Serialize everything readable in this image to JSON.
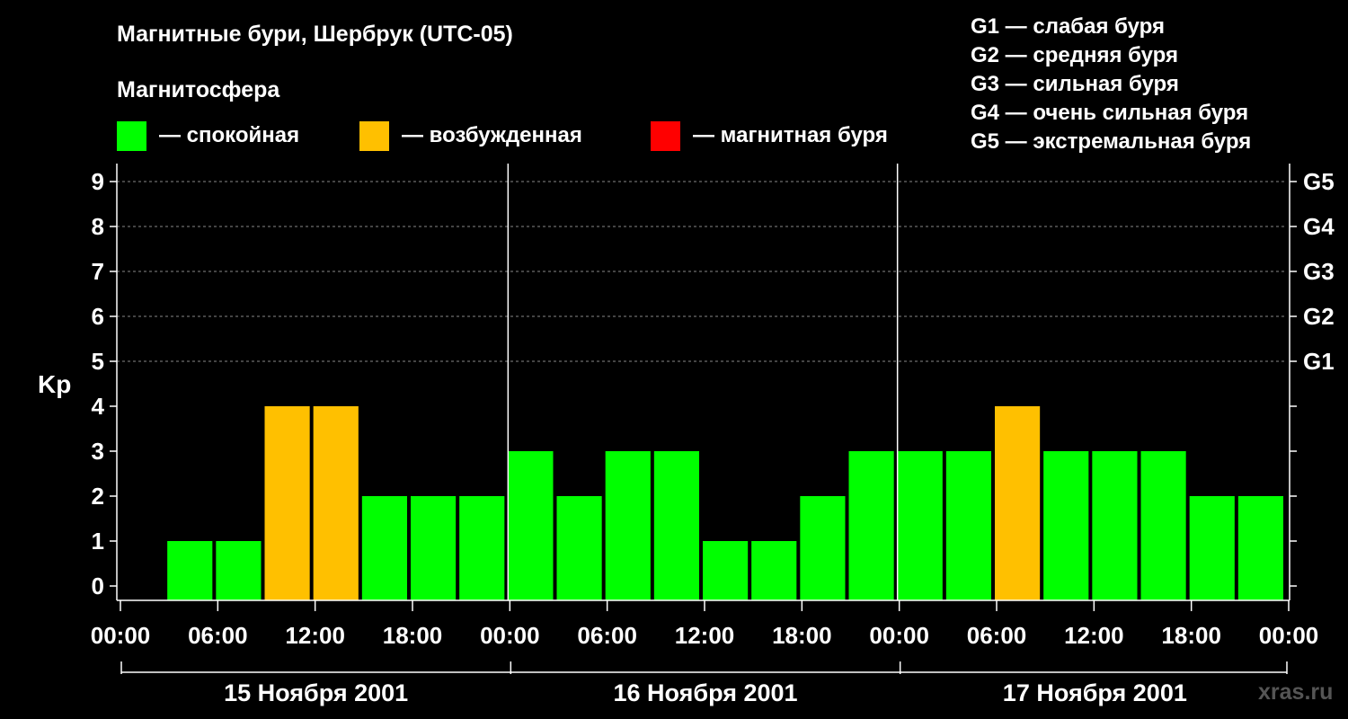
{
  "title": "Магнитные бури, Шербрук (UTC-05)",
  "subtitle": "Магнитосфера",
  "legend": [
    {
      "label": "— спокойная",
      "color": "#00ff00"
    },
    {
      "label": "— возбужденная",
      "color": "#ffc000"
    },
    {
      "label": "— магнитная буря",
      "color": "#ff0000"
    }
  ],
  "g_scale": [
    "G1 — слабая буря",
    "G2 — средняя буря",
    "G3 — сильная буря",
    "G4 — очень сильная буря",
    "G5 — экстремальная буря"
  ],
  "watermark": "xras.ru",
  "chart_data": {
    "type": "bar",
    "ylabel": "Kp",
    "ylim": [
      0,
      9
    ],
    "yticks": [
      0,
      1,
      2,
      3,
      4,
      5,
      6,
      7,
      8,
      9
    ],
    "right_ticks": [
      {
        "value": 5,
        "label": "G1"
      },
      {
        "value": 6,
        "label": "G2"
      },
      {
        "value": 7,
        "label": "G3"
      },
      {
        "value": 8,
        "label": "G4"
      },
      {
        "value": 9,
        "label": "G5"
      }
    ],
    "xticks": [
      "00:00",
      "06:00",
      "12:00",
      "18:00",
      "00:00",
      "06:00",
      "12:00",
      "18:00",
      "00:00",
      "06:00",
      "12:00",
      "18:00",
      "00:00"
    ],
    "days": [
      "15 Ноября 2001",
      "16 Ноября 2001",
      "17 Ноября 2001"
    ],
    "interval_hours": 3,
    "values": [
      0,
      1,
      1,
      4,
      4,
      2,
      2,
      2,
      3,
      2,
      3,
      3,
      1,
      1,
      2,
      3,
      3,
      3,
      4,
      3,
      3,
      3,
      2,
      2
    ],
    "colors": {
      "quiet": "#00ff00",
      "active": "#ffc000",
      "storm": "#ff0000"
    },
    "thresholds": {
      "active": 4,
      "storm": 5
    },
    "grid": true
  }
}
